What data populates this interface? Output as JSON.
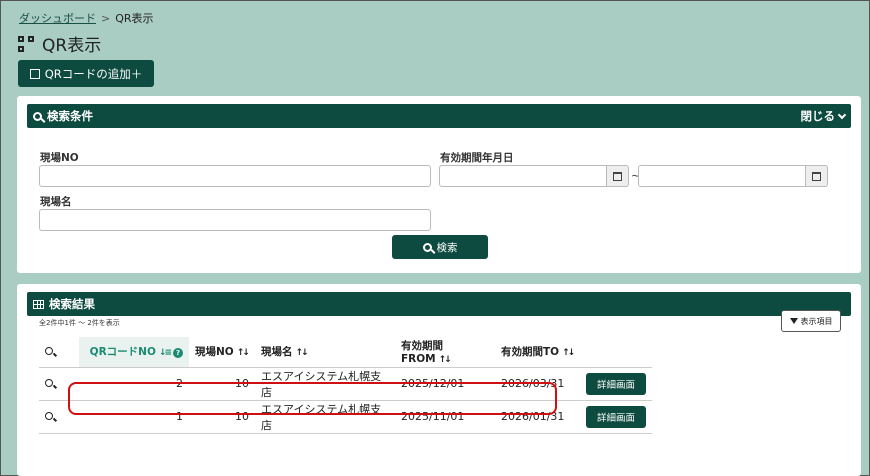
{
  "breadcrumb": {
    "home": "ダッシュボード",
    "separator": ">",
    "current": "QR表示"
  },
  "page": {
    "title": "QR表示"
  },
  "add_button": {
    "label": "QRコードの追加＋"
  },
  "search_panel": {
    "title": "検索条件",
    "close_label": "閉じる",
    "site_no_label": "現場NO",
    "site_name_label": "現場名",
    "period_label": "有効期間年月日",
    "range_separator": "~",
    "search_button": "検索",
    "site_no_value": "",
    "site_name_value": "",
    "date_from_value": "",
    "date_to_value": ""
  },
  "results_panel": {
    "title": "検索結果",
    "count_text": "全2件中1件 ～ 2件を表示",
    "display_items_button": "表示項目",
    "columns": [
      "QRコードNO",
      "現場NO",
      "現場名",
      "有効期間FROM",
      "有効期間TO"
    ],
    "help_glyph": "?",
    "rows": [
      {
        "qr_no": "2",
        "site_no": "10",
        "site_name": "エスアイシステム札幌支店",
        "from": "2025/12/01",
        "to": "2026/03/31",
        "detail": "詳細画面"
      },
      {
        "qr_no": "1",
        "site_no": "10",
        "site_name": "エスアイシステム札幌支店",
        "from": "2025/11/01",
        "to": "2026/01/31",
        "detail": "詳細画面"
      }
    ]
  },
  "colors": {
    "background": "#a9cdc3",
    "primary": "#0d4a3f",
    "accent": "#1a8a70",
    "highlight": "#d01010"
  }
}
